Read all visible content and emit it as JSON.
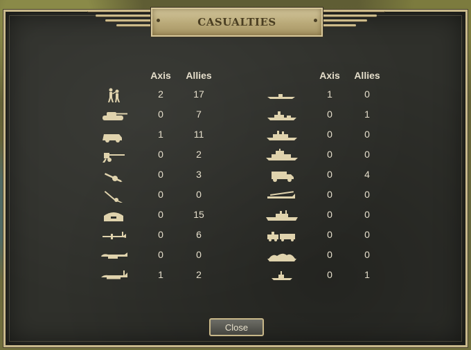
{
  "dialog": {
    "title": "CASUALTIES",
    "close_label": "Close"
  },
  "table": {
    "left_headers": {
      "axis": "Axis",
      "allies": "Allies"
    },
    "right_headers": {
      "axis": "Axis",
      "allies": "Allies"
    },
    "left_rows": [
      {
        "icon": "infantry-icon",
        "axis": "2",
        "allies": "17"
      },
      {
        "icon": "tank-icon",
        "axis": "0",
        "allies": "7"
      },
      {
        "icon": "recon-vehicle-icon",
        "axis": "1",
        "allies": "11"
      },
      {
        "icon": "anti-tank-gun-icon",
        "axis": "0",
        "allies": "2"
      },
      {
        "icon": "artillery-icon",
        "axis": "0",
        "allies": "3"
      },
      {
        "icon": "anti-air-gun-icon",
        "axis": "0",
        "allies": "0"
      },
      {
        "icon": "fortification-icon",
        "axis": "0",
        "allies": "15"
      },
      {
        "icon": "fighter-icon",
        "axis": "0",
        "allies": "6"
      },
      {
        "icon": "tactical-bomber-icon",
        "axis": "0",
        "allies": "0"
      },
      {
        "icon": "strategic-bomber-icon",
        "axis": "1",
        "allies": "2"
      }
    ],
    "right_rows": [
      {
        "icon": "submarine-icon",
        "axis": "1",
        "allies": "0"
      },
      {
        "icon": "destroyer-icon",
        "axis": "0",
        "allies": "1"
      },
      {
        "icon": "cruiser-icon",
        "axis": "0",
        "allies": "0"
      },
      {
        "icon": "battleship-icon",
        "axis": "0",
        "allies": "0"
      },
      {
        "icon": "truck-icon",
        "axis": "0",
        "allies": "4"
      },
      {
        "icon": "transport-plane-icon",
        "axis": "0",
        "allies": "0"
      },
      {
        "icon": "carrier-icon",
        "axis": "0",
        "allies": "0"
      },
      {
        "icon": "armored-train-icon",
        "axis": "0",
        "allies": "0"
      },
      {
        "icon": "landing-craft-icon",
        "axis": "0",
        "allies": "0"
      },
      {
        "icon": "transport-ship-icon",
        "axis": "0",
        "allies": "1"
      }
    ]
  },
  "colors": {
    "text": "#e6dfcc",
    "icon": "#e0d3ad",
    "border": "#c9b98b",
    "panel": "#2f302b"
  }
}
